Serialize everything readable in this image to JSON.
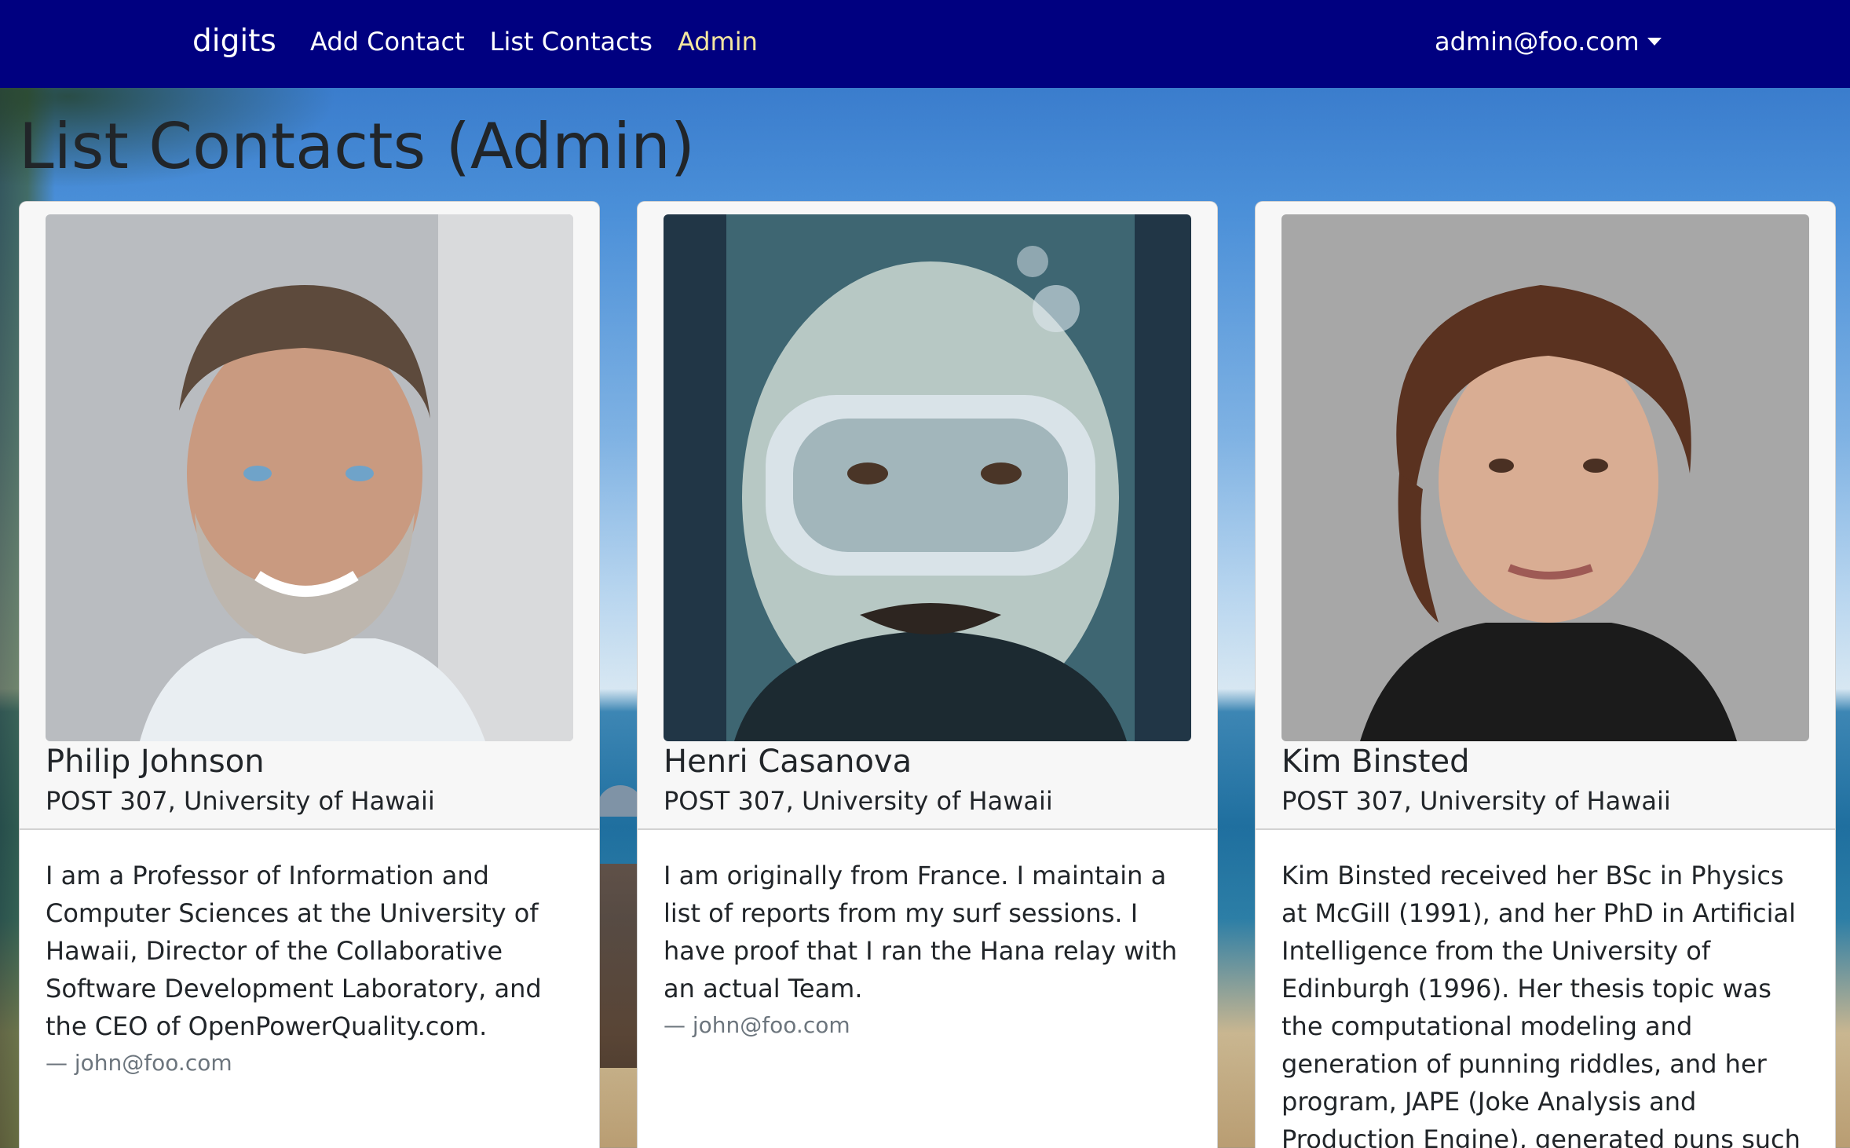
{
  "navbar": {
    "brand": "digits",
    "links": [
      {
        "label": "Add Contact"
      },
      {
        "label": "List Contacts"
      },
      {
        "label": "Admin"
      }
    ],
    "user": "admin@foo.com"
  },
  "page": {
    "title": "List Contacts (Admin)"
  },
  "contacts": [
    {
      "name": "Philip Johnson",
      "address": "POST 307, University of Hawaii",
      "description": "I am a Professor of Information and Computer Sciences at the University of Hawaii, Director of the Collaborative Software Development Laboratory, and the CEO of OpenPowerQuality.com.",
      "owner": "— john@foo.com"
    },
    {
      "name": "Henri Casanova",
      "address": "POST 307, University of Hawaii",
      "description": "I am originally from France. I maintain a list of reports from my surf sessions. I have proof that I ran the Hana relay with an actual Team.",
      "owner": "— john@foo.com"
    },
    {
      "name": "Kim Binsted",
      "address": "POST 307, University of Hawaii",
      "description": "Kim Binsted received her BSc in Physics at McGill (1991), and her PhD in Artificial Intelligence from the University of Edinburgh (1996). Her thesis topic was the computational modeling and generation of punning riddles, and her program, JAPE (Joke Analysis and Production Engine), generated puns such as 'What do you call a",
      "owner": ""
    }
  ],
  "colors": {
    "navbar": "#000080",
    "active_link": "#f5e7a0"
  }
}
